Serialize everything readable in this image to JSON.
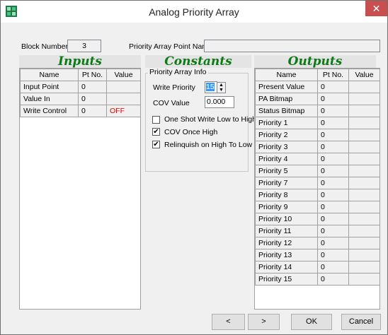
{
  "window": {
    "title": "Analog Priority Array",
    "close_glyph": "✕"
  },
  "header": {
    "block_number_label": "Block Number:",
    "block_number_value": "3",
    "pa_point_name_label": "Priority Array Point Name:",
    "pa_point_name_value": ""
  },
  "sections": {
    "inputs": "Inputs",
    "constants": "Constants",
    "outputs": "Outputs"
  },
  "inputs": {
    "columns": [
      "Name",
      "Pt No.",
      "Value"
    ],
    "rows": [
      {
        "name": "Input Point",
        "pt": "0",
        "value": ""
      },
      {
        "name": "Value In",
        "pt": "0",
        "value": ""
      },
      {
        "name": "Write Control",
        "pt": "0",
        "value": "OFF"
      }
    ],
    "off_color": "#e00000"
  },
  "constants": {
    "group_title": "Priority Array Info",
    "write_priority_label": "Write Priority",
    "write_priority_value": "15",
    "cov_value_label": "COV Value",
    "cov_value": "0.000",
    "one_shot_label": "One Shot Write Low to High",
    "one_shot_checked": false,
    "cov_once_high_label": "COV Once High",
    "cov_once_high_checked": true,
    "relinquish_label": "Relinquish on High To Low",
    "relinquish_checked": true,
    "check_glyph": "✔"
  },
  "outputs": {
    "columns": [
      "Name",
      "Pt No.",
      "Value"
    ],
    "rows": [
      {
        "name": "Present Value",
        "pt": "0"
      },
      {
        "name": "PA Bitmap",
        "pt": "0"
      },
      {
        "name": "Status Bitmap",
        "pt": "0"
      },
      {
        "name": "Priority 1",
        "pt": "0"
      },
      {
        "name": "Priority 2",
        "pt": "0"
      },
      {
        "name": "Priority 3",
        "pt": "0"
      },
      {
        "name": "Priority 4",
        "pt": "0"
      },
      {
        "name": "Priority 5",
        "pt": "0"
      },
      {
        "name": "Priority 7",
        "pt": "0"
      },
      {
        "name": "Priority 8",
        "pt": "0"
      },
      {
        "name": "Priority 9",
        "pt": "0"
      },
      {
        "name": "Priority 10",
        "pt": "0"
      },
      {
        "name": "Priority 11",
        "pt": "0"
      },
      {
        "name": "Priority 12",
        "pt": "0"
      },
      {
        "name": "Priority 13",
        "pt": "0"
      },
      {
        "name": "Priority 14",
        "pt": "0"
      },
      {
        "name": "Priority 15",
        "pt": "0"
      }
    ]
  },
  "buttons": {
    "prev": "<",
    "next": ">",
    "ok": "OK",
    "cancel": "Cancel"
  },
  "spin_glyphs": {
    "up": "▲",
    "down": "▼"
  },
  "colors": {
    "heading_green": "#0c7a16",
    "close_red": "#c74f50",
    "selected_blue": "#3399ff"
  },
  "icons": {
    "app": "app-icon"
  }
}
